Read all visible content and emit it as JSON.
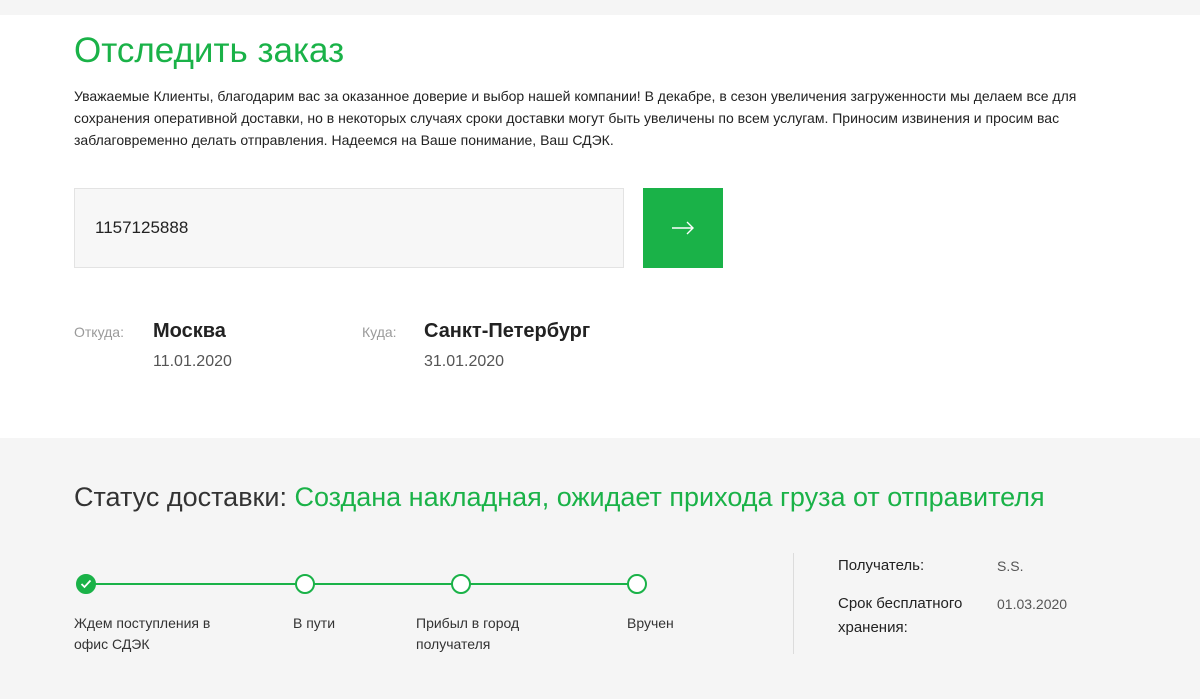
{
  "page": {
    "title": "Отследить заказ",
    "notice": "Уважаемые Клиенты, благодарим вас за оказанное доверие и выбор нашей компании! В декабре, в сезон увеличения загруженности мы делаем все для сохранения оперативной доставки, но в некоторых случаях сроки доставки могут быть увеличены по всем услугам. Приносим извинения и просим вас заблаговременно делать отправления. Надеемся на Ваше понимание, Ваш СДЭК."
  },
  "search": {
    "value": "1157125888",
    "submit_icon": "arrow-right-icon"
  },
  "route": {
    "from_label": "Откуда:",
    "from_city": "Москва",
    "from_date": "11.01.2020",
    "to_label": "Куда:",
    "to_city": "Санкт-Петербург",
    "to_date": "31.01.2020"
  },
  "status": {
    "label": "Статус доставки:",
    "value": "Создана накладная, ожидает прихода груза от отправителя",
    "steps": [
      {
        "label": "Ждем поступления в офис СДЭК",
        "done": true
      },
      {
        "label": "В пути",
        "done": false
      },
      {
        "label": "Прибыл в город получателя",
        "done": false
      },
      {
        "label": "Вручен",
        "done": false
      }
    ]
  },
  "info": {
    "recipient_label": "Получатель:",
    "recipient_value": "S.S.",
    "storage_label": "Срок бесплатного хранения:",
    "storage_value": "01.03.2020"
  },
  "colors": {
    "accent": "#1ab248",
    "background": "#f5f5f5",
    "card": "#ffffff"
  }
}
